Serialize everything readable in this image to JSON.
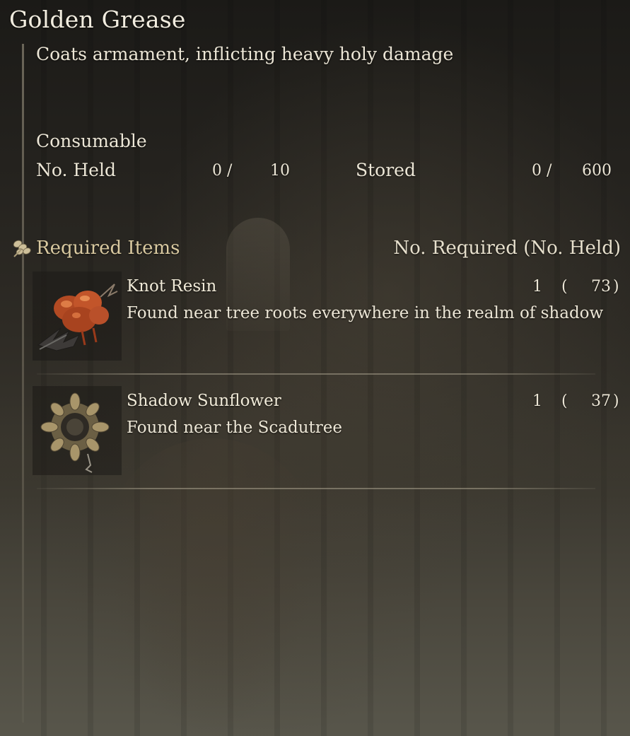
{
  "item": {
    "title": "Golden Grease",
    "description": "Coats armament, inflicting heavy holy damage",
    "category": "Consumable"
  },
  "inventory": {
    "held_label": "No. Held",
    "held_current": "0 /",
    "held_max": "10",
    "stored_label": "Stored",
    "stored_current": "0 /",
    "stored_max": "600"
  },
  "required": {
    "header_label": "Required Items",
    "column_label": "No. Required (No. Held)",
    "icon": "crafting-materials-icon",
    "items": [
      {
        "name": "Knot Resin",
        "description": "Found near tree roots everywhere in the realm of shadow",
        "required": "1",
        "paren_open": "(",
        "held": "73",
        "paren_close": ")",
        "icon": "knot-resin-icon"
      },
      {
        "name": "Shadow Sunflower",
        "description": "Found near the Scadutree",
        "required": "1",
        "paren_open": "(",
        "held": "37",
        "paren_close": ")",
        "icon": "shadow-sunflower-icon"
      }
    ]
  }
}
